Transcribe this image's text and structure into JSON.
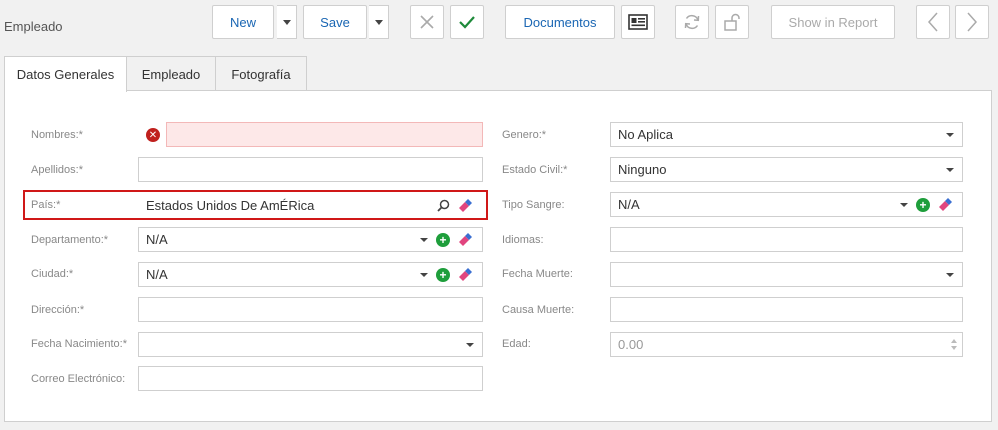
{
  "header": {
    "title": "Empleado"
  },
  "toolbar": {
    "new_label": "New",
    "save_label": "Save",
    "documentos_label": "Documentos",
    "show_in_report_label": "Show in Report"
  },
  "tabs": [
    {
      "label": "Datos Generales"
    },
    {
      "label": "Empleado"
    },
    {
      "label": "Fotografía"
    }
  ],
  "form": {
    "left": {
      "nombres": {
        "label": "Nombres:*",
        "value": ""
      },
      "apellidos": {
        "label": "Apellidos:*",
        "value": ""
      },
      "pais": {
        "label": "País:*",
        "value": "Estados Unidos De AmÉRica"
      },
      "departamento": {
        "label": "Departamento:*",
        "value": "N/A"
      },
      "ciudad": {
        "label": "Ciudad:*",
        "value": "N/A"
      },
      "direccion": {
        "label": "Dirección:*",
        "value": ""
      },
      "fecha_nacimiento": {
        "label": "Fecha Nacimiento:*",
        "value": ""
      },
      "correo": {
        "label": "Correo Electrónico:",
        "value": ""
      }
    },
    "right": {
      "genero": {
        "label": "Genero:*",
        "value": "No Aplica"
      },
      "estado_civil": {
        "label": "Estado Civil:*",
        "value": "Ninguno"
      },
      "tipo_sangre": {
        "label": "Tipo Sangre:",
        "value": "N/A"
      },
      "idiomas": {
        "label": "Idiomas:",
        "value": ""
      },
      "fecha_muerte": {
        "label": "Fecha Muerte:",
        "value": ""
      },
      "causa_muerte": {
        "label": "Causa Muerte:",
        "value": ""
      },
      "edad": {
        "label": "Edad:",
        "value": "0.00"
      }
    }
  },
  "colors": {
    "accent": "#1a66b3",
    "add": "#1e9e3b",
    "error": "#c0201d",
    "highlight": "#d01818"
  }
}
